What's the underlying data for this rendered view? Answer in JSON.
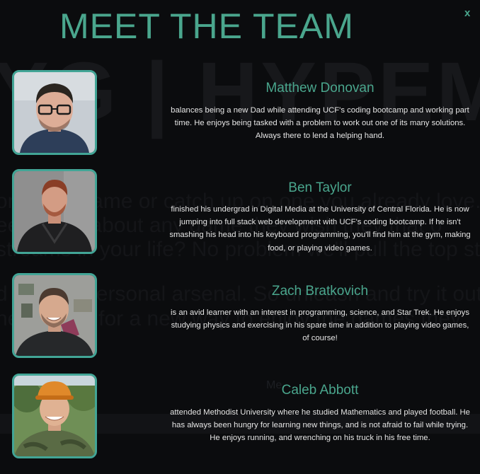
{
  "background": {
    "headline": "YG | HYPEM",
    "lines": [
      "onfer no game or catch up on one you already love.",
      "ee! Know about any game they wish they that o",
      "streams in your life? No problem we'll pull the top streams",
      "d to your personal arsenal. So unleash and try it out",
      "ne looking for a new way to enjoy the games they"
    ],
    "small_label": "Me"
  },
  "modal": {
    "title": "MEET THE TEAM",
    "close_label": "x"
  },
  "team": [
    {
      "name": "Matthew Donovan",
      "bio": "balances being a new Dad while attending UCF's coding bootcamp and working part time. He enjoys being tasked with a problem to work out one of its many solutions. Always there to lend a helping hand."
    },
    {
      "name": "Ben Taylor",
      "bio": "finished his undergrad in Digital Media at the University of Central Florida. He is now jumping into full stack web development with UCF's coding bootcamp. If he isn't smashing his head into his keyboard programming, you'll find him at the gym, making food, or playing video games."
    },
    {
      "name": "Zach Bratkovich",
      "bio": "is an avid learner with an interest in programming, science, and Star Trek. He enjoys studying physics and exercising in his spare time in addition to playing video games, of course!"
    },
    {
      "name": "Caleb Abbott",
      "bio": "attended Methodist University where he studied Mathematics and played football. He has always been hungry for learning new things, and is not afraid to fail while trying. He enjoys running, and wrenching on his truck in his free time."
    }
  ]
}
